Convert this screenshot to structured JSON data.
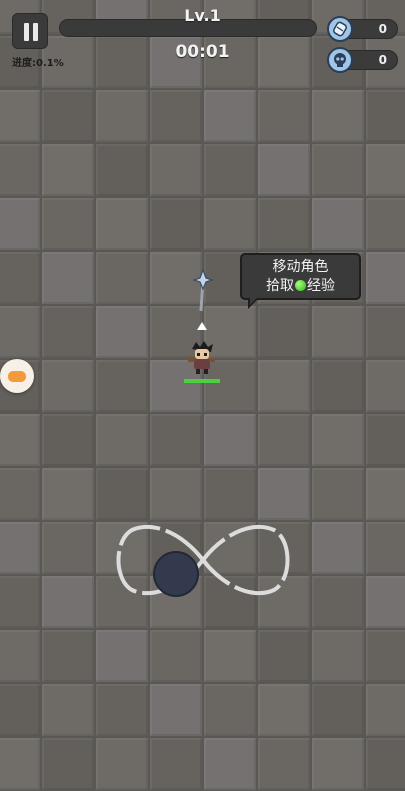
{
  "hud": {
    "level": "Lv.1",
    "timer": "00:01",
    "progress_text": "进度:0.1%",
    "xp_fraction": 0.0
  },
  "counters": [
    {
      "icon": "gem-icon",
      "value": "0"
    },
    {
      "icon": "skull-icon",
      "value": "0"
    }
  ],
  "tutorial": {
    "line1": "移动角色",
    "line2_before": "拾取",
    "line2_after": "经验"
  },
  "player": {
    "hp_fraction": 1.0
  },
  "colors": {
    "xp_green": "#4bd13f",
    "tooltip_bg": "#3a3a3a",
    "floor": "#6b6864",
    "pad_orange": "#f39b3a"
  }
}
